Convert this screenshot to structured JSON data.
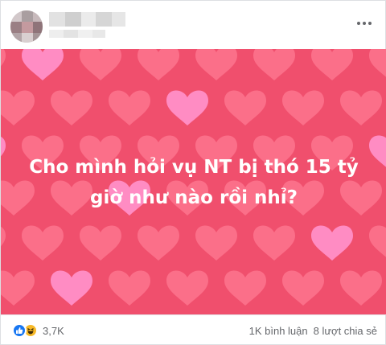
{
  "post": {
    "text": "Cho mình hỏi vụ NT bị thó 15 tỷ giờ như nào rồi nhỉ?",
    "background_color": "#f04f6d",
    "heart_colors": [
      "#ff7a93",
      "#ff8fc8"
    ]
  },
  "header": {
    "more_icon": "more-horizontal-icon"
  },
  "footer": {
    "reaction_icons": [
      "like-icon",
      "haha-icon"
    ],
    "reaction_count": "3,7K",
    "comments": "1K bình luận",
    "shares": "8 lượt chia sẻ"
  }
}
